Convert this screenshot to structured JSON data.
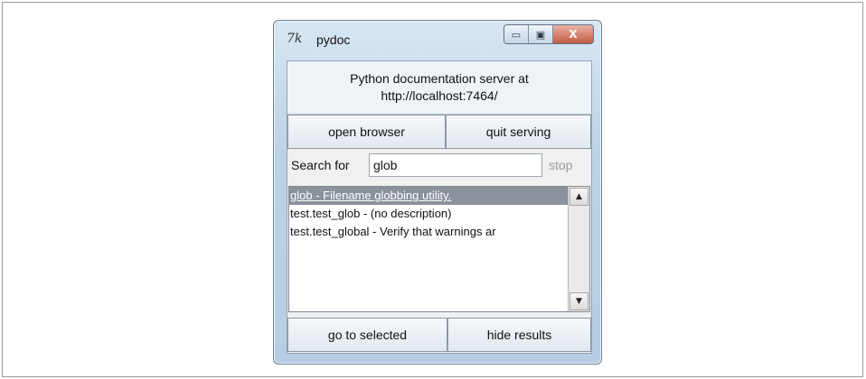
{
  "window": {
    "title": "pydoc",
    "tk_logo": "7k",
    "controls": {
      "minimize": "▭",
      "maximize": "▣",
      "close": "X"
    }
  },
  "server": {
    "line1": "Python documentation server at",
    "line2": "http://localhost:7464/"
  },
  "buttons": {
    "open_browser": "open browser",
    "quit_serving": "quit serving",
    "go_to_selected": "go to selected",
    "hide_results": "hide results"
  },
  "search": {
    "label": "Search for",
    "value": "glob",
    "stop_label": "stop"
  },
  "results": [
    {
      "text": "glob - Filename globbing utility.",
      "selected": true
    },
    {
      "text": "test.test_glob - (no description)",
      "selected": false
    },
    {
      "text": "test.test_global - Verify that warnings ar",
      "selected": false
    }
  ],
  "scrollbar": {
    "up": "▲",
    "down": "▼"
  }
}
